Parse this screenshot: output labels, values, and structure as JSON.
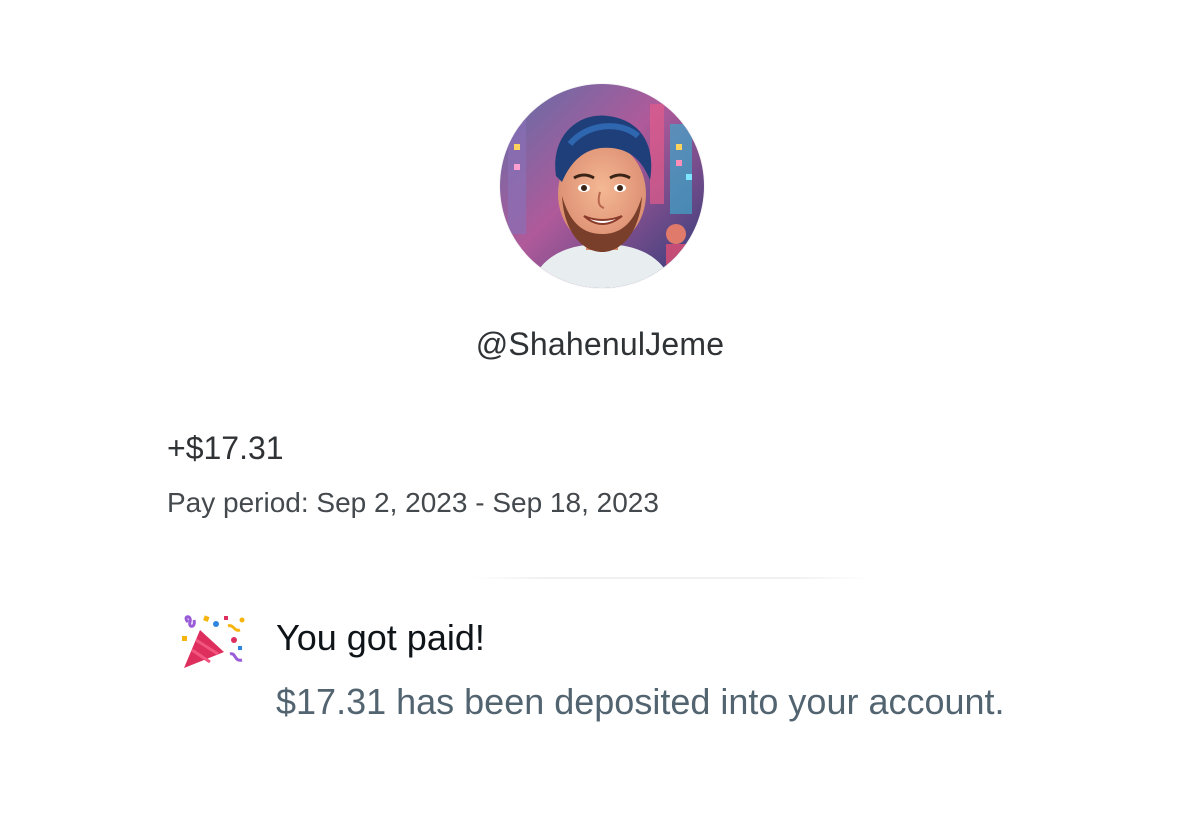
{
  "profile": {
    "avatar_icon": "avatar-illustration",
    "username": "@ShahenulJeme"
  },
  "payout": {
    "amount": "+$17.31",
    "pay_period": "Pay period: Sep 2, 2023 - Sep 18, 2023"
  },
  "notification": {
    "icon": "party-popper-icon",
    "title": "You got paid!",
    "body": "$17.31 has been deposited into your account."
  },
  "colors": {
    "primary_text": "#0f1419",
    "secondary_text": "#536471",
    "background": "#ffffff"
  }
}
